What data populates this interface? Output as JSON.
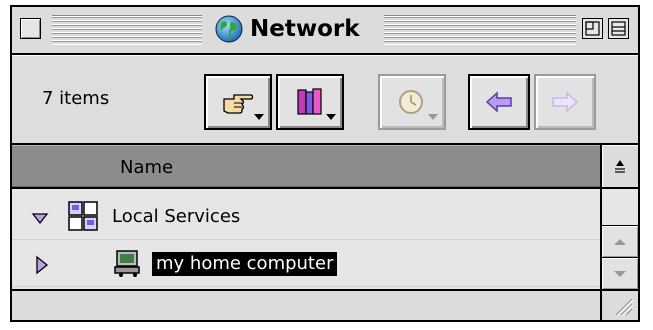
{
  "window": {
    "title": "Network",
    "icon": "globe-icon"
  },
  "header": {
    "items_count": "7 items",
    "toolbar": [
      {
        "icon": "pointing-hand-icon",
        "has_menu": true,
        "enabled": true
      },
      {
        "icon": "books-icon",
        "has_menu": true,
        "enabled": true
      },
      {
        "icon": "clock-icon",
        "has_menu": true,
        "enabled": false
      },
      {
        "icon": "back-arrow-icon",
        "has_menu": false,
        "enabled": true
      },
      {
        "icon": "forward-arrow-icon",
        "has_menu": false,
        "enabled": false
      }
    ]
  },
  "list": {
    "column_name": "Name",
    "rows": [
      {
        "label": "Local Services",
        "icon": "local-services-icon",
        "expanded": true,
        "selected": false
      },
      {
        "label": "my home computer",
        "icon": "computer-icon",
        "expanded": false,
        "selected": true
      }
    ]
  },
  "colors": {
    "window_bg": "#dddddd",
    "column_header_bg": "#8c8c8c",
    "list_bg": "#e6e6e6",
    "selection_bg": "#000000",
    "selection_text": "#ffffff",
    "arrow_enabled": "#7a4fcf",
    "arrow_disabled": "#c9bde6"
  }
}
